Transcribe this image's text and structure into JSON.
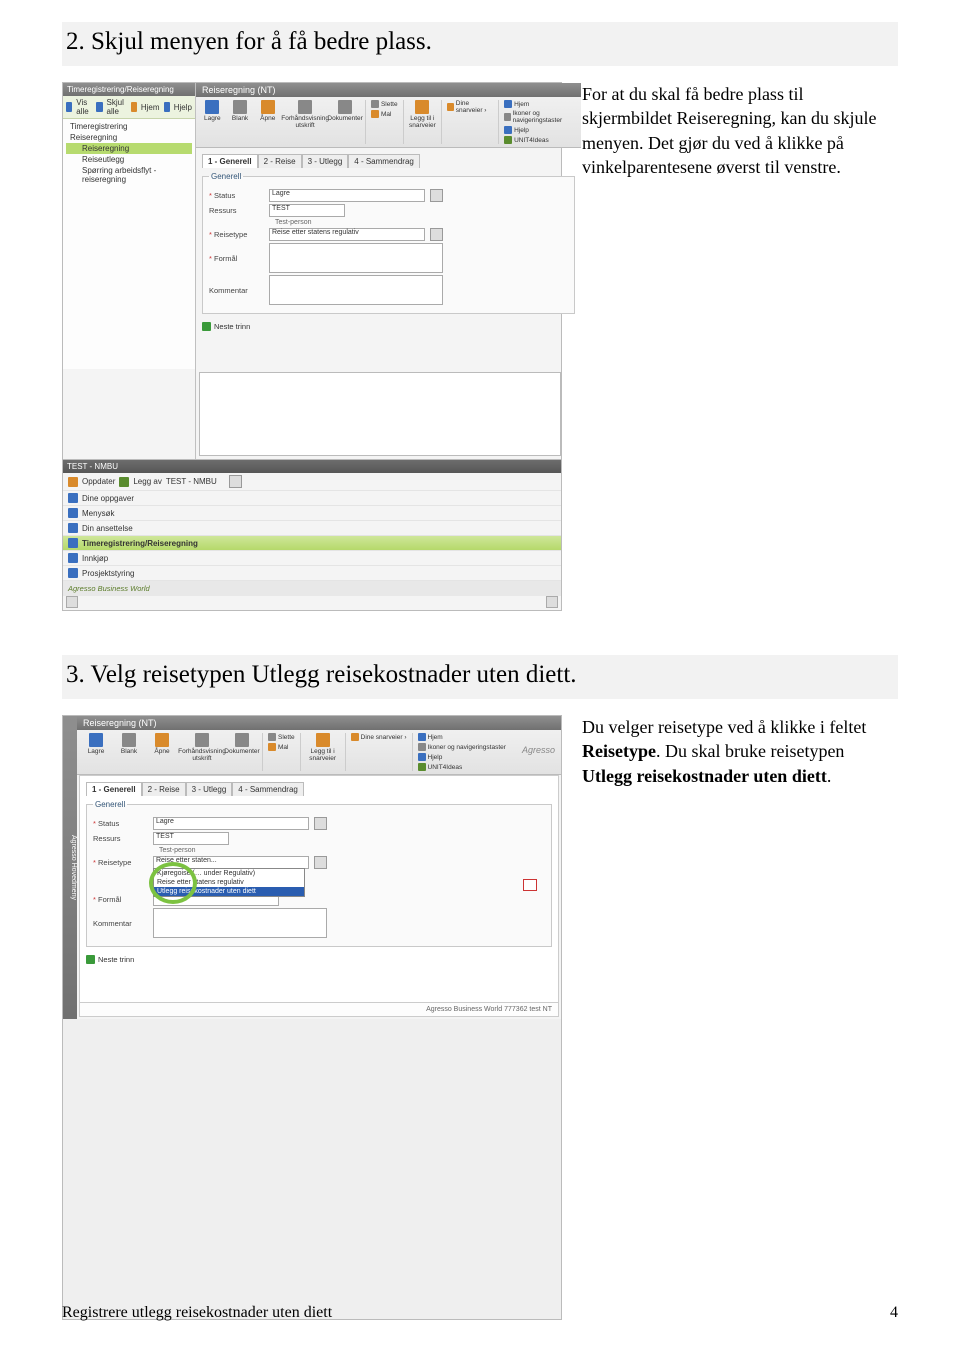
{
  "step2": {
    "heading": "2. Skjul menyen for å få bedre plass.",
    "explain_line1": "For at du skal få bedre plass til skjermbildet Reiseregning, kan du skjule menyen. Det gjør du ved å klikke på vinkelparentesene øverst til venstre."
  },
  "shot1": {
    "nav_title": "Timeregistrering/Reiseregning",
    "nav_btns": [
      "Vis alle",
      "Skjul alle",
      "Hjem",
      "Hjelp"
    ],
    "tree": [
      "Timeregistrering",
      "Reiseregning",
      "Reiseregning",
      "Reiseutlegg",
      "Spørring arbeidsflyt - reiseregning"
    ],
    "main_title": "Reiseregning (NT)",
    "toolbar_btns": [
      "Lagre",
      "Blank",
      "Åpne",
      "Forhåndsvisning utskrift",
      "Dokumenter"
    ],
    "toolbar_side1_x": "Slette",
    "toolbar_side1_star": "Mal",
    "toolbar_center": "Legg til i snarveier",
    "toolbar_side2_star": "Dine snarveier ›",
    "toolbar_side3_i": "Hjem",
    "toolbar_side3_keys": "Ikoner og navigeringstaster",
    "toolbar_side3_help": "Hjelp",
    "toolbar_side3_u4": "UNIT4Ideas",
    "tabs": [
      "1 - Generell",
      "2 - Reise",
      "3 - Utlegg",
      "4 - Sammendrag"
    ],
    "form_legend": "Generell",
    "f_status": "Status",
    "f_status_v": "Lagre",
    "f_ressurs": "Ressurs",
    "f_ressurs_v": "TEST",
    "f_ressurs_sub": "Test-person",
    "f_reisetype": "Reisetype",
    "f_reisetype_v": "Reise etter statens regulativ",
    "f_formaal": "Formål",
    "f_kommentar": "Kommentar",
    "next_btn": "Neste trinn",
    "bn_title": "TEST - NMBU",
    "bn_update": "Oppdater",
    "bn_add": "Legg av",
    "bn_select": "TEST - NMBU",
    "bn_rows": [
      "Dine oppgaver",
      "Menysøk",
      "Din ansettelse",
      "Timeregistrering/Reiseregning",
      "Innkjøp",
      "Prosjektstyring"
    ],
    "bn_footer": "Agresso Business World"
  },
  "step3": {
    "heading": "3. Velg reisetypen Utlegg reisekostnader uten diett.",
    "explain": "Du velger reisetype ved å klikke i feltet ",
    "explain_b1": "Reisetype",
    "explain_mid": ". Du skal bruke reisetypen ",
    "explain_b2": "Utlegg reisekostnader uten diett",
    "explain_end": "."
  },
  "shot2": {
    "sidetab": "Agresso Hovedmeny",
    "main_title": "Reiseregning (NT)",
    "brand": "Agresso",
    "tabs": [
      "1 - Generell",
      "2 - Reise",
      "3 - Utlegg",
      "4 - Sammendrag"
    ],
    "form_legend": "Generell",
    "f_status": "Status",
    "f_status_v": "Lagre",
    "f_ressurs": "Ressurs",
    "f_ressurs_v": "TEST",
    "f_ressurs_sub": "Test-person",
    "f_reisetype": "Reisetype",
    "f_reisetype_v": "Reise etter staten...",
    "dd": [
      "Kjøregoise (… under Regulativ)",
      "Reise etter statens regulativ",
      "Utlegg reisekostnader uten diett"
    ],
    "f_formaal": "Formål",
    "f_kommentar": "Kommentar",
    "next_btn": "Neste trinn",
    "status": "Agresso Business World  777362  test  NT"
  },
  "footer": {
    "left": "Registrere utlegg reisekostnader uten diett",
    "page": "4"
  }
}
